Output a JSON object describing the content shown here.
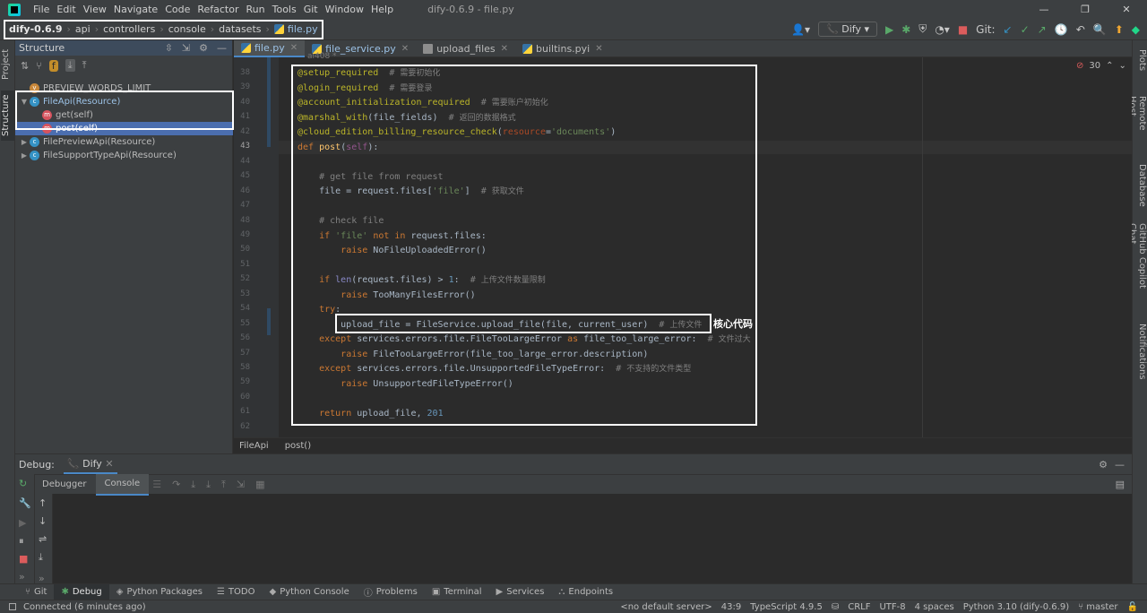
{
  "app": {
    "window_title": "dify-0.6.9 - file.py",
    "menu": [
      "File",
      "Edit",
      "View",
      "Navigate",
      "Code",
      "Refactor",
      "Run",
      "Tools",
      "Git",
      "Window",
      "Help"
    ],
    "window_controls": [
      "—",
      "❐",
      "✕"
    ]
  },
  "navbar": {
    "breadcrumbs": [
      "dify-0.6.9",
      "api",
      "controllers",
      "console",
      "datasets",
      "file.py"
    ],
    "run_config": "Dify",
    "git_label": "Git:"
  },
  "tool_windows_left": [
    "Project",
    "Structure"
  ],
  "tool_windows_right": [
    "Plots",
    "Remote Host",
    "Database",
    "GitHub Copilot Chat",
    "Notifications"
  ],
  "structure": {
    "title": "Structure",
    "items": [
      {
        "kind": "v",
        "label": "PREVIEW_WORDS_LIMIT",
        "indent": 0,
        "arrow": ""
      },
      {
        "kind": "c",
        "label": "FileApi(Resource)",
        "indent": 0,
        "arrow": "▼"
      },
      {
        "kind": "m",
        "label": "get(self)",
        "indent": 1,
        "arrow": ""
      },
      {
        "kind": "m",
        "label": "post(self)",
        "indent": 1,
        "arrow": "",
        "selected": true
      },
      {
        "kind": "c",
        "label": "FilePreviewApi(Resource)",
        "indent": 0,
        "arrow": "▶"
      },
      {
        "kind": "c",
        "label": "FileSupportTypeApi(Resource)",
        "indent": 0,
        "arrow": "▶"
      }
    ]
  },
  "editor_tabs": [
    {
      "label": "file.py",
      "active": true
    },
    {
      "label": "file_service.py",
      "active": false
    },
    {
      "label": "upload_files",
      "active": false
    },
    {
      "label": "builtins.pyi",
      "active": false
    }
  ],
  "editor": {
    "author_hint": "ai408 *",
    "error_count": "30",
    "current_line": 43,
    "line_numbers": [
      38,
      39,
      40,
      41,
      42,
      43,
      44,
      45,
      46,
      47,
      48,
      49,
      50,
      51,
      52,
      53,
      54,
      55,
      56,
      57,
      58,
      59,
      60,
      61,
      62
    ],
    "core_label": "核心代码"
  },
  "code_breadcrumb": [
    "FileApi",
    "post()"
  ],
  "debug": {
    "label": "Debug:",
    "config": "Dify",
    "tabs": [
      "Debugger",
      "Console"
    ]
  },
  "bottom_tabs": [
    "Git",
    "Debug",
    "Python Packages",
    "TODO",
    "Python Console",
    "Problems",
    "Terminal",
    "Services",
    "Endpoints"
  ],
  "status": {
    "message": "Connected (6 minutes ago)",
    "items": [
      "<no default server>",
      "43:9",
      "TypeScript 4.9.5",
      "CRLF",
      "UTF-8",
      "4 spaces",
      "Python 3.10 (dify-0.6.9)",
      "master"
    ]
  }
}
